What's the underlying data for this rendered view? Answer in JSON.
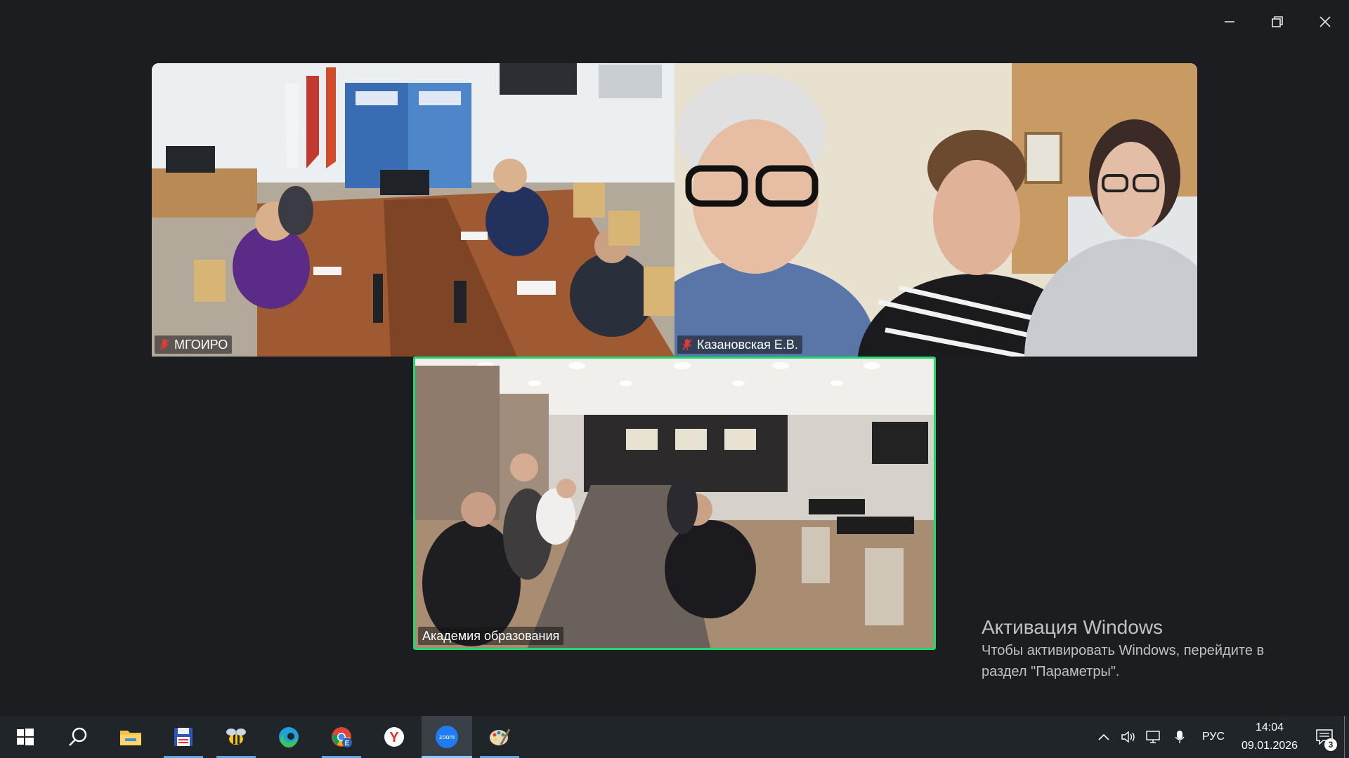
{
  "window": {
    "controls": [
      "minimize",
      "maximize",
      "close"
    ]
  },
  "tiles": [
    {
      "label": "МГОИРО",
      "muted": true,
      "active": false
    },
    {
      "label": "Казановская Е.В.",
      "muted": true,
      "active": false
    },
    {
      "label": "Академия образования",
      "muted": false,
      "active": true
    }
  ],
  "activation": {
    "title": "Активация Windows",
    "text": "Чтобы активировать Windows, перейдите в раздел \"Параметры\"."
  },
  "taskbar": {
    "apps": [
      {
        "icon": "windows-start-icon",
        "running": false,
        "active": false
      },
      {
        "icon": "search-icon",
        "running": false,
        "active": false
      },
      {
        "icon": "file-explorer-icon",
        "running": false,
        "active": false
      },
      {
        "icon": "save-disk-app-icon",
        "running": true,
        "active": false
      },
      {
        "icon": "bee-app-icon",
        "running": true,
        "active": false
      },
      {
        "icon": "edge-browser-icon",
        "running": false,
        "active": false
      },
      {
        "icon": "chrome-browser-icon",
        "running": true,
        "active": false
      },
      {
        "icon": "yandex-browser-icon",
        "running": false,
        "active": false
      },
      {
        "icon": "zoom-app-icon",
        "running": true,
        "active": true
      },
      {
        "icon": "paint-app-icon",
        "running": true,
        "active": false
      }
    ],
    "zoom_label": "zoom",
    "yandex_letter": "Y",
    "chrome_badge": "E",
    "tray": {
      "icons": [
        "chevron-up-icon",
        "volume-icon",
        "network-icon",
        "microphone-icon"
      ],
      "language": "РУС",
      "time": "14:04",
      "date": "09.01.2026",
      "notifications_count": "3"
    }
  },
  "colors": {
    "background": "#1b1d20",
    "active_speaker_border": "#23d96b",
    "taskbar": "#1f2529",
    "muted_mic": "#e5393b"
  }
}
